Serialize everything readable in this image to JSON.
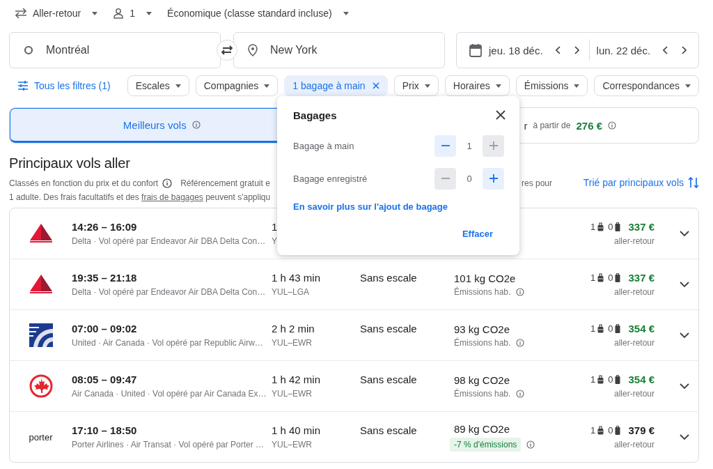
{
  "trip_bar": {
    "trip_type": "Aller-retour",
    "passengers": "1",
    "cabin": "Économique (classe standard incluse)"
  },
  "search": {
    "origin": "Montréal",
    "destination": "New York",
    "depart_date": "jeu. 18 déc.",
    "return_date": "lun. 22 déc."
  },
  "filters": {
    "all_filters": "Tous les filtres (1)",
    "chips": [
      {
        "label": "Escales",
        "selected": false
      },
      {
        "label": "Compagnies",
        "selected": false
      },
      {
        "label": "1 bagage à main",
        "selected": true
      },
      {
        "label": "Prix",
        "selected": false
      },
      {
        "label": "Horaires",
        "selected": false
      },
      {
        "label": "Émissions",
        "selected": false
      },
      {
        "label": "Correspondances",
        "selected": false
      }
    ]
  },
  "tabs": [
    {
      "label": "Meilleurs vols",
      "selected": true
    },
    {
      "label": "r",
      "selected": false,
      "from_label": "à partir de",
      "price": "276 €"
    }
  ],
  "results": {
    "title": "Principaux vols aller",
    "notice_line1": "Classés en fonction du prix et du confort",
    "notice_line1_after": "Référencement gratuit e",
    "notice_line1_end": "res pour",
    "notice_line2": "1 adulte. Des frais facultatifs et des **frais de bagages** peuvent s'appliqu",
    "sort_link": "Trié par principaux vols"
  },
  "flights": [
    {
      "logo": {
        "kind": "triangle"
      },
      "times": "14:26 – 16:09",
      "airlines": "Delta · Vol opéré par Endeavor Air DBA Delta Con…",
      "duration": "1",
      "route": "Y",
      "carry_on": "1",
      "checked": "0",
      "price": "337 €",
      "price_highlight": true,
      "price_note": "aller-retour"
    },
    {
      "logo": {
        "kind": "triangle"
      },
      "times": "19:35 – 21:18",
      "airlines": "Delta · Vol opéré par Endeavor Air DBA Delta Con…",
      "duration": "1 h 43 min",
      "route": "YUL–LGA",
      "stops": "Sans escale",
      "emissions": "101 kg CO2e",
      "emissions_note": {
        "kind": "typical",
        "text": "Émissions hab."
      },
      "carry_on": "1",
      "checked": "0",
      "price": "337 €",
      "price_highlight": true,
      "price_note": "aller-retour"
    },
    {
      "logo": {
        "kind": "globe"
      },
      "times": "07:00 – 09:02",
      "airlines": "United · Air Canada · Vol opéré par Republic Airw…",
      "duration": "2 h 2 min",
      "route": "YUL–EWR",
      "stops": "Sans escale",
      "emissions": "93 kg CO2e",
      "emissions_note": {
        "kind": "typical",
        "text": "Émissions hab."
      },
      "carry_on": "1",
      "checked": "0",
      "price": "354 €",
      "price_highlight": true,
      "price_note": "aller-retour"
    },
    {
      "logo": {
        "kind": "leaf"
      },
      "times": "08:05 – 09:47",
      "airlines": "Air Canada · United · Vol opéré par Air Canada Ex…",
      "duration": "1 h 42 min",
      "route": "YUL–EWR",
      "stops": "Sans escale",
      "emissions": "98 kg CO2e",
      "emissions_note": {
        "kind": "typical",
        "text": "Émissions hab."
      },
      "carry_on": "1",
      "checked": "0",
      "price": "354 €",
      "price_highlight": true,
      "price_note": "aller-retour"
    },
    {
      "logo": {
        "kind": "wordmark",
        "text": "porter"
      },
      "times": "17:10 – 18:50",
      "airlines": "Porter Airlines · Air Transat · Vol opéré par Porter …",
      "duration": "1 h 40 min",
      "route": "YUL–EWR",
      "stops": "Sans escale",
      "emissions": "89 kg CO2e",
      "emissions_note": {
        "kind": "lower",
        "text": "-7 % d'émissions"
      },
      "carry_on": "1",
      "checked": "0",
      "price": "379 €",
      "price_highlight": false,
      "price_note": "aller-retour"
    }
  ],
  "baggage_popup": {
    "title": "Bagages",
    "steppers": [
      {
        "label": "Bagage à main",
        "value": "1",
        "minus_disabled": false,
        "plus_disabled": true
      },
      {
        "label": "Bagage enregistré",
        "value": "0",
        "minus_disabled": true,
        "plus_disabled": false
      }
    ],
    "learn_more": "En savoir plus sur l'ajout de bagage",
    "clear": "Effacer"
  }
}
